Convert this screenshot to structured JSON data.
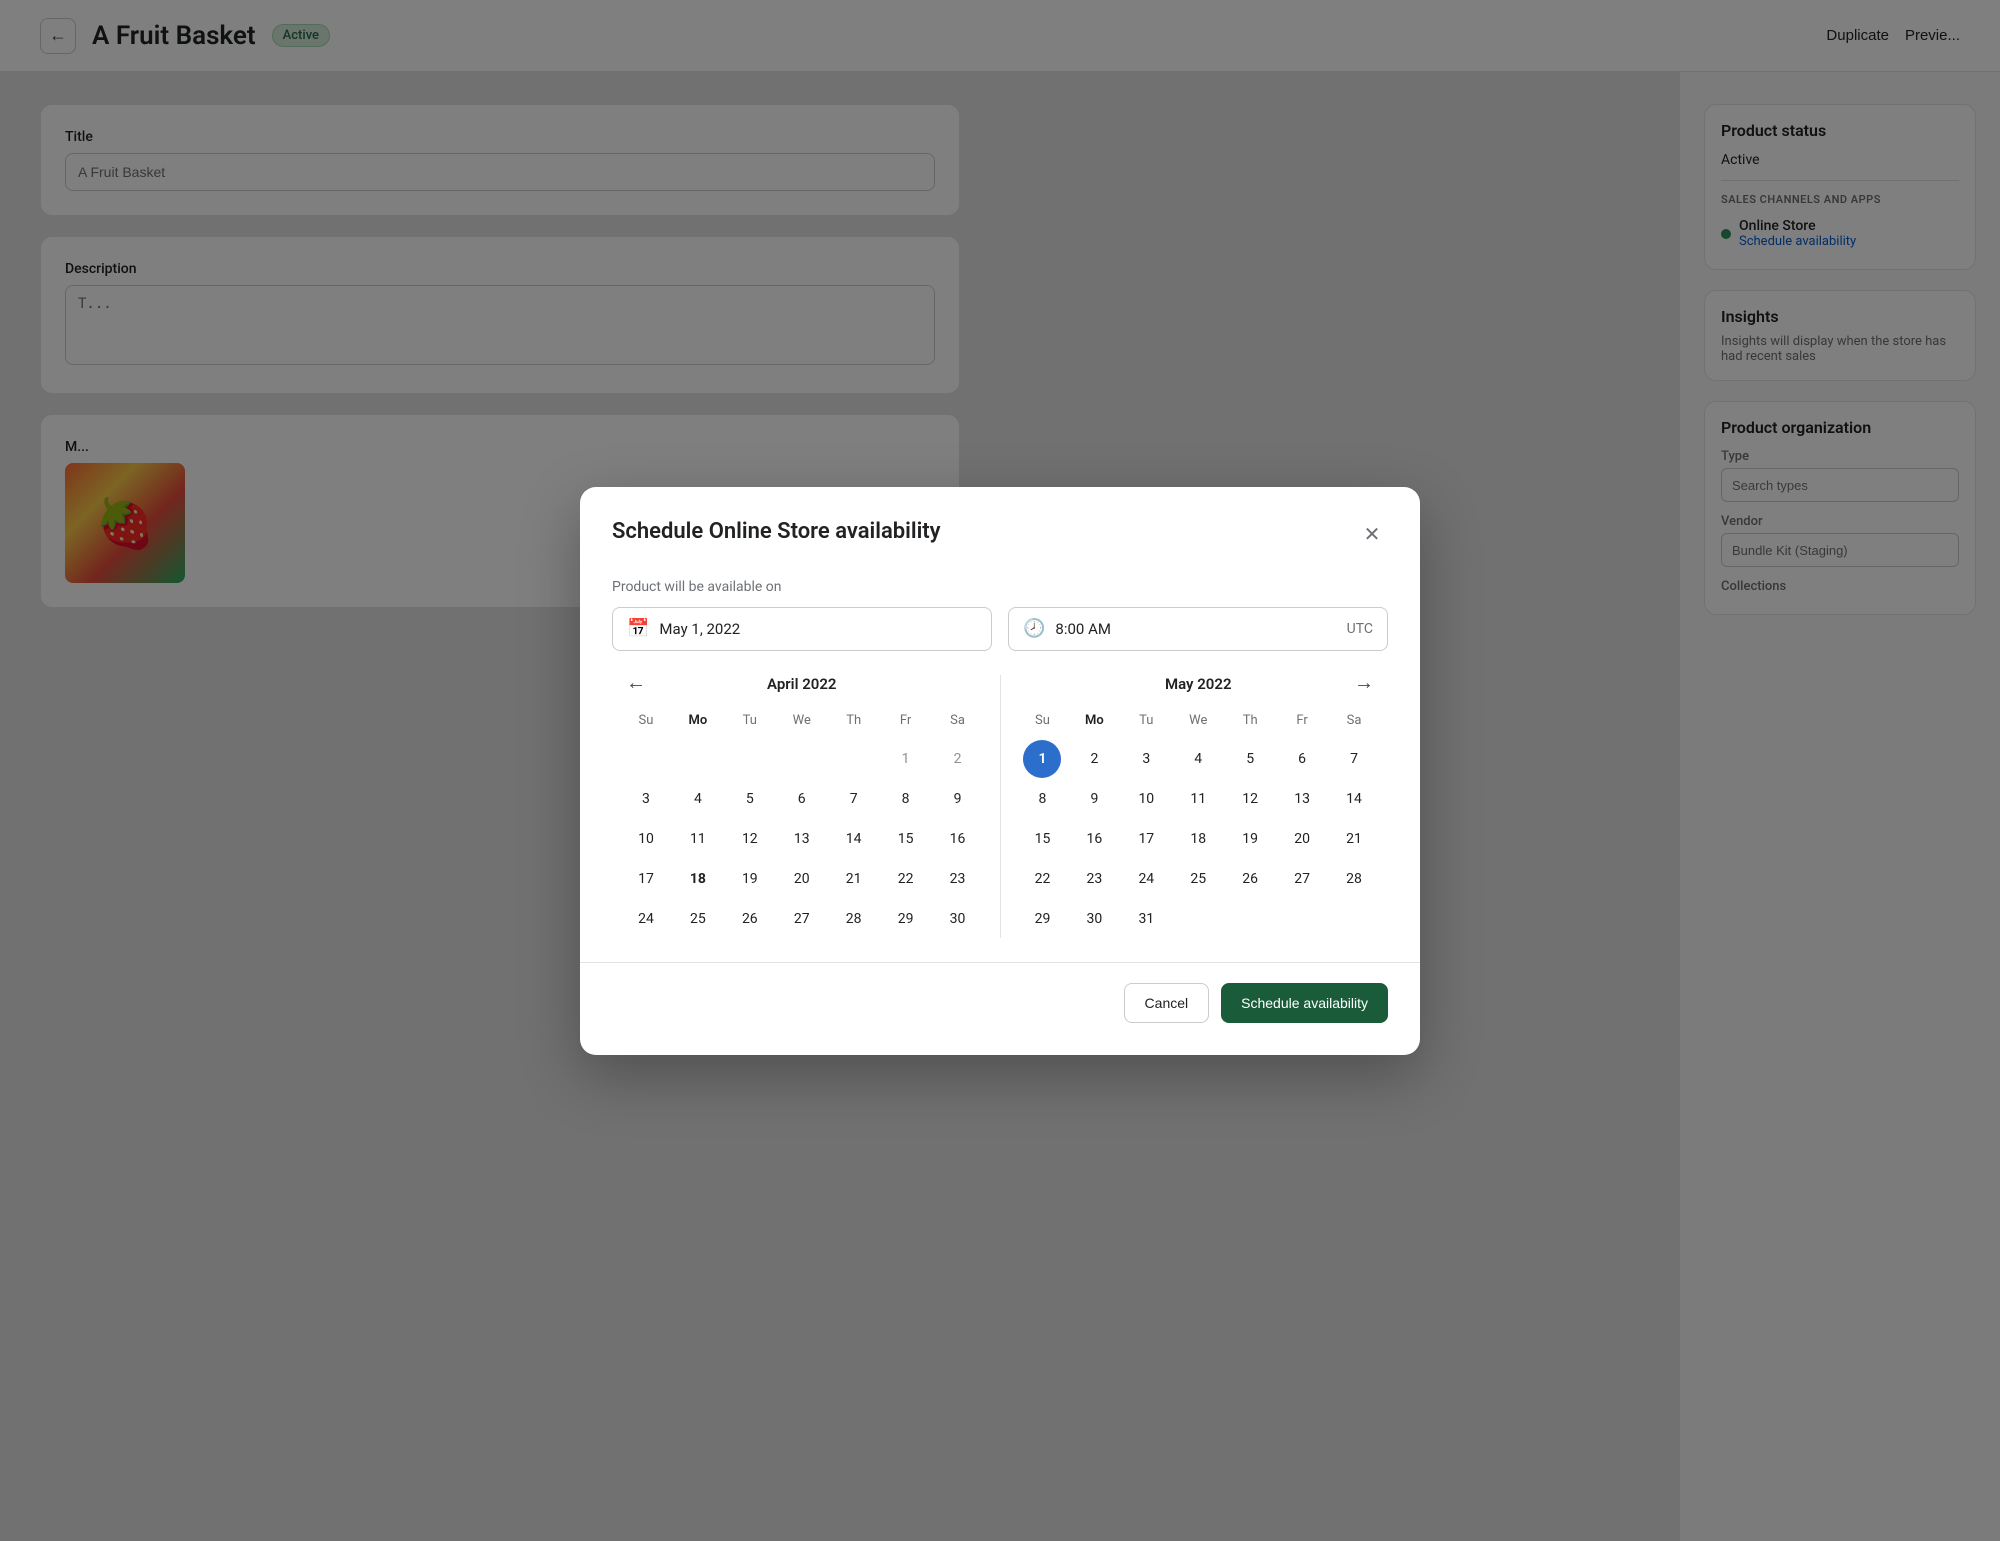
{
  "topbar": {
    "back_label": "←",
    "title": "A Fruit Basket",
    "badge": "Active",
    "duplicate_label": "Duplicate",
    "preview_label": "Previe..."
  },
  "form": {
    "title_label": "Title",
    "title_value": "A Fruit Basket",
    "description_label": "Description",
    "description_placeholder": "T..."
  },
  "sidebar": {
    "product_status_title": "Product status",
    "active_label": "Active",
    "sales_channels_label": "SALES CHANNELS AND APPS",
    "channel_name": "Online Store",
    "channel_link": "Schedule availability",
    "insights_title": "Insights",
    "insights_text": "Insights will display when the store has had recent sales",
    "product_org_title": "Product organization",
    "type_label": "Type",
    "type_placeholder": "Search types",
    "vendor_label": "Vendor",
    "vendor_value": "Bundle Kit (Staging)",
    "collections_label": "Collections"
  },
  "media": {
    "label": "M...",
    "emoji": "🍓"
  },
  "modal": {
    "title": "Schedule Online Store availability",
    "product_available_label": "Product will be available on",
    "date_value": "May 1, 2022",
    "time_value": "8:00 AM",
    "timezone": "UTC",
    "april_title": "April 2022",
    "may_title": "May 2022",
    "weekdays": [
      "Su",
      "Mo",
      "Tu",
      "We",
      "Th",
      "Fr",
      "Sa"
    ],
    "bold_weekday_index": 1,
    "april_days": [
      {
        "day": "",
        "type": "empty"
      },
      {
        "day": "",
        "type": "empty"
      },
      {
        "day": "",
        "type": "empty"
      },
      {
        "day": "",
        "type": "empty"
      },
      {
        "day": "",
        "type": "empty"
      },
      {
        "day": "1",
        "type": "gray"
      },
      {
        "day": "2",
        "type": "gray"
      },
      {
        "day": "3",
        "type": "normal"
      },
      {
        "day": "4",
        "type": "normal"
      },
      {
        "day": "5",
        "type": "normal"
      },
      {
        "day": "6",
        "type": "normal"
      },
      {
        "day": "7",
        "type": "normal"
      },
      {
        "day": "8",
        "type": "normal"
      },
      {
        "day": "9",
        "type": "normal"
      },
      {
        "day": "10",
        "type": "normal"
      },
      {
        "day": "11",
        "type": "normal"
      },
      {
        "day": "12",
        "type": "normal"
      },
      {
        "day": "13",
        "type": "normal"
      },
      {
        "day": "14",
        "type": "normal"
      },
      {
        "day": "15",
        "type": "normal"
      },
      {
        "day": "16",
        "type": "normal"
      },
      {
        "day": "17",
        "type": "normal"
      },
      {
        "day": "18",
        "type": "today"
      },
      {
        "day": "19",
        "type": "normal"
      },
      {
        "day": "20",
        "type": "normal"
      },
      {
        "day": "21",
        "type": "normal"
      },
      {
        "day": "22",
        "type": "normal"
      },
      {
        "day": "23",
        "type": "normal"
      },
      {
        "day": "24",
        "type": "normal"
      },
      {
        "day": "25",
        "type": "normal"
      },
      {
        "day": "26",
        "type": "normal"
      },
      {
        "day": "27",
        "type": "normal"
      },
      {
        "day": "28",
        "type": "normal"
      },
      {
        "day": "29",
        "type": "normal"
      },
      {
        "day": "30",
        "type": "normal"
      }
    ],
    "may_days": [
      {
        "day": "1",
        "type": "selected"
      },
      {
        "day": "2",
        "type": "normal"
      },
      {
        "day": "3",
        "type": "normal"
      },
      {
        "day": "4",
        "type": "normal"
      },
      {
        "day": "5",
        "type": "normal"
      },
      {
        "day": "6",
        "type": "normal"
      },
      {
        "day": "7",
        "type": "normal"
      },
      {
        "day": "8",
        "type": "normal"
      },
      {
        "day": "9",
        "type": "normal"
      },
      {
        "day": "10",
        "type": "normal"
      },
      {
        "day": "11",
        "type": "normal"
      },
      {
        "day": "12",
        "type": "normal"
      },
      {
        "day": "13",
        "type": "normal"
      },
      {
        "day": "14",
        "type": "normal"
      },
      {
        "day": "15",
        "type": "normal"
      },
      {
        "day": "16",
        "type": "normal"
      },
      {
        "day": "17",
        "type": "normal"
      },
      {
        "day": "18",
        "type": "normal"
      },
      {
        "day": "19",
        "type": "normal"
      },
      {
        "day": "20",
        "type": "normal"
      },
      {
        "day": "21",
        "type": "normal"
      },
      {
        "day": "22",
        "type": "normal"
      },
      {
        "day": "23",
        "type": "normal"
      },
      {
        "day": "24",
        "type": "normal"
      },
      {
        "day": "25",
        "type": "normal"
      },
      {
        "day": "26",
        "type": "normal"
      },
      {
        "day": "27",
        "type": "normal"
      },
      {
        "day": "28",
        "type": "normal"
      },
      {
        "day": "29",
        "type": "normal"
      },
      {
        "day": "30",
        "type": "normal"
      },
      {
        "day": "31",
        "type": "normal"
      },
      {
        "day": "",
        "type": "empty"
      },
      {
        "day": "",
        "type": "empty"
      },
      {
        "day": "",
        "type": "empty"
      }
    ],
    "cancel_label": "Cancel",
    "schedule_label": "Schedule availability"
  }
}
